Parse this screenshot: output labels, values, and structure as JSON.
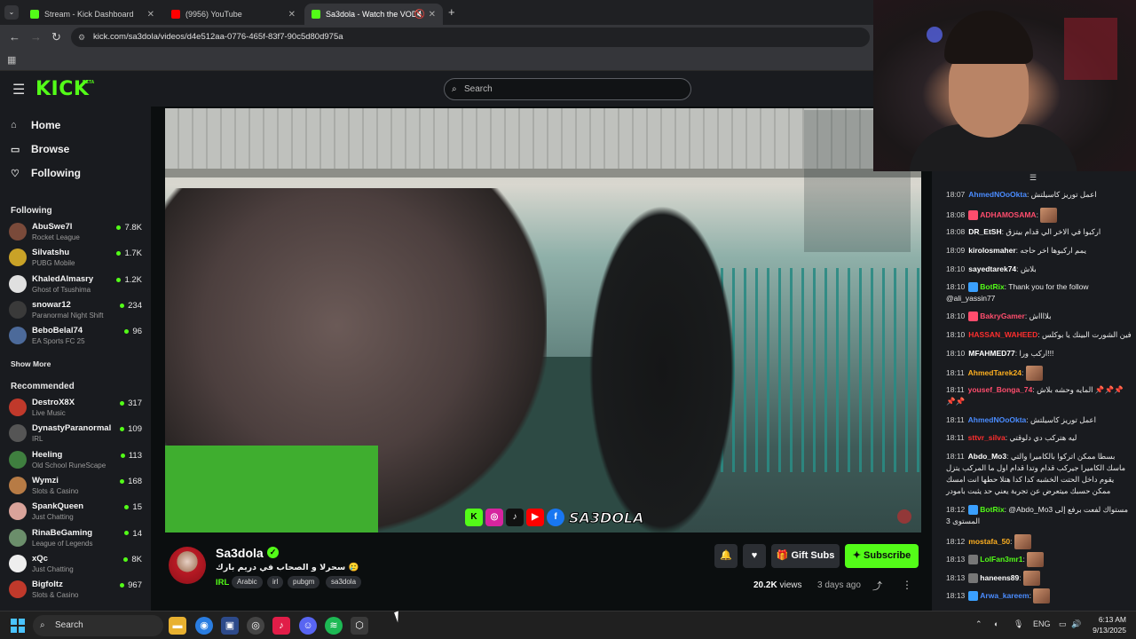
{
  "browser": {
    "tabs": [
      {
        "title": "Stream - Kick Dashboard",
        "favicon_color": "#53fc18"
      },
      {
        "title": "(9956) YouTube",
        "favicon_color": "#ff0000"
      },
      {
        "title": "Sa3dola - Watch the VOD o",
        "favicon_color": "#53fc18"
      }
    ],
    "url": "kick.com/sa3dola/videos/d4e512aa-0776-465f-83f7-90c5d80d975a"
  },
  "header": {
    "logo": "KICK",
    "beta": "BETA",
    "search_placeholder": "Search"
  },
  "sidebar": {
    "nav": [
      {
        "label": "Home",
        "icon": "home-icon"
      },
      {
        "label": "Browse",
        "icon": "browse-icon"
      },
      {
        "label": "Following",
        "icon": "heart-icon"
      }
    ],
    "following_title": "Following",
    "following": [
      {
        "name": "AbuSwe7l",
        "game": "Rocket League",
        "viewers": "7.8K",
        "color": "#7a4a3a"
      },
      {
        "name": "Silvatshu",
        "game": "PUBG Mobile",
        "viewers": "1.7K",
        "color": "#c9a227"
      },
      {
        "name": "KhaledAlmasry",
        "game": "Ghost of Tsushima",
        "viewers": "1.2K",
        "color": "#e0e0e0"
      },
      {
        "name": "snowar12",
        "game": "Paranormal Night Shift",
        "viewers": "234",
        "color": "#3a3a3a"
      },
      {
        "name": "BeboBelal74",
        "game": "EA Sports FC 25",
        "viewers": "96",
        "color": "#4c6a9a"
      }
    ],
    "show_more": "Show More",
    "recommended_title": "Recommended",
    "recommended": [
      {
        "name": "DestroX8X",
        "game": "Live Music",
        "viewers": "317",
        "color": "#c0392b"
      },
      {
        "name": "DynastyParanormal",
        "game": "IRL",
        "viewers": "109",
        "color": "#555555"
      },
      {
        "name": "Heeling",
        "game": "Old School RuneScape",
        "viewers": "113",
        "color": "#3f7f3f"
      },
      {
        "name": "Wymzi",
        "game": "Slots & Casino",
        "viewers": "168",
        "color": "#b77b45"
      },
      {
        "name": "SpankQueen",
        "game": "Just Chatting",
        "viewers": "15",
        "color": "#d9a39a"
      },
      {
        "name": "RinaBeGaming",
        "game": "League of Legends",
        "viewers": "14",
        "color": "#6b8e6b"
      },
      {
        "name": "xQc",
        "game": "Just Chatting",
        "viewers": "8K",
        "color": "#eeeeee"
      },
      {
        "name": "Bigfoltz",
        "game": "Slots & Casino",
        "viewers": "967",
        "color": "#c0392b"
      }
    ]
  },
  "stream": {
    "name": "Sa3dola",
    "title": "سحرلا و الصحاب في دريم بارك 🥲",
    "category": "IRL",
    "tags": [
      "Arabic",
      "irl",
      "pubgm",
      "sa3dola"
    ],
    "watermark": "SA3DOLA",
    "buttons": {
      "gift": "Gift Subs",
      "subscribe": "Subscribe"
    },
    "views_count": "20.2K",
    "views_label": "views",
    "ago": "3 days ago"
  },
  "chat": [
    {
      "time": "18:07",
      "user": "AhmedNOoOkta",
      "color": "#4a8cff",
      "text": "اعمل توريز كاسيلتش"
    },
    {
      "time": "18:08",
      "user": "ADHAMOSAMA",
      "color": "#ff4d6d",
      "text": "",
      "emote": true,
      "badge": "#ff4d6d"
    },
    {
      "time": "18:08",
      "user": "DR_EtSH",
      "color": "#ffffff",
      "text": "اركبوا في الاخر الي قدام بيتزق"
    },
    {
      "time": "18:09",
      "user": "kirolosmaher",
      "color": "#ffffff",
      "text": "يمم اركبوها اخر حاجه"
    },
    {
      "time": "18:10",
      "user": "sayedtarek74",
      "color": "#ffffff",
      "text": "بلاش"
    },
    {
      "time": "18:10",
      "user": "BotRix",
      "color": "#53fc18",
      "text": "Thank you for the follow @ali_yassin77",
      "badge": "#3aa0ff"
    },
    {
      "time": "18:10",
      "user": "BakryGamer",
      "color": "#ff4d6d",
      "text": "بلااااش",
      "badge": "#ff4d6d"
    },
    {
      "time": "18:10",
      "user": "HASSAN_WAHEED",
      "color": "#ff2e2e",
      "text": "فين الشورت البينك يا بوكلس"
    },
    {
      "time": "18:10",
      "user": "MFAHMED77",
      "color": "#ffffff",
      "text": "اركب ورا!!!"
    },
    {
      "time": "18:11",
      "user": "AhmedTarek24",
      "color": "#ffb020",
      "text": "",
      "emote": true
    },
    {
      "time": "18:11",
      "user": "yousef_Bonga_74",
      "color": "#ff4d6d",
      "text": "المايه وحشه بلاش 📌📌📌📌📌"
    },
    {
      "time": "18:11",
      "user": "AhmedNOoOkta",
      "color": "#4a8cff",
      "text": "اعمل توريز كاسيلتش"
    },
    {
      "time": "18:11",
      "user": "sttvr_silva",
      "color": "#ff2e2e",
      "text": "ليه هتركب دي دلوقتي"
    },
    {
      "time": "18:11",
      "user": "Abdo_Mo3",
      "color": "#ffffff",
      "text": "بسطا ممكن اتركوا بالكاميرا والتي ماسك الكاميرا جيركب قدام وتدا قدام اول ما المركب يتزل يقوم داخل الحتت الخشبه كدا كدا هتلا حطها انت امسك ممكن حسبك ميتعرض عن تجربة يعني حد يثبت بامودر"
    },
    {
      "time": "18:12",
      "user": "BotRix",
      "color": "#53fc18",
      "text": "@Abdo_Mo3 مستواك لفعت برفع إلى المستوى 3",
      "badge": "#3aa0ff"
    },
    {
      "time": "18:12",
      "user": "mostafa_50",
      "color": "#ffb020",
      "text": "",
      "emote": true
    },
    {
      "time": "18:13",
      "user": "LolFan3mr1",
      "color": "#53fc18",
      "text": "",
      "emote": true,
      "badge": "#777777"
    },
    {
      "time": "18:13",
      "user": "haneens89",
      "color": "#ffffff",
      "text": "",
      "emote": true,
      "badge": "#777777"
    },
    {
      "time": "18:13",
      "user": "Arwa_kareem",
      "color": "#4a8cff",
      "text": "",
      "emote": true,
      "badge": "#3aa0ff"
    }
  ],
  "taskbar": {
    "search": "Search",
    "lang": "ENG",
    "time": "6:13 AM",
    "date": "9/13/2025"
  }
}
